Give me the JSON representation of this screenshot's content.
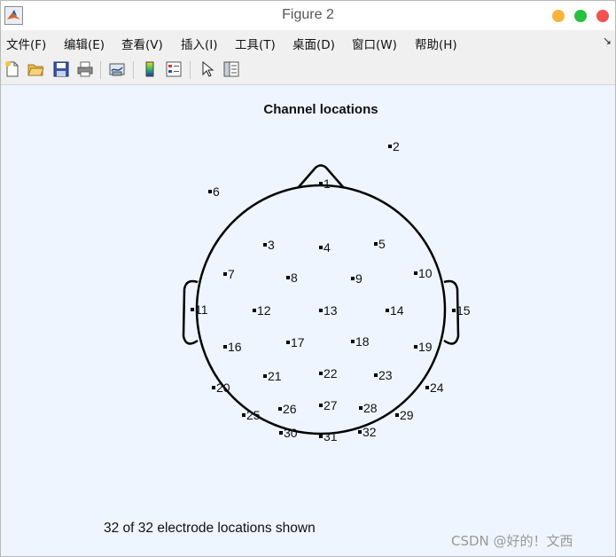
{
  "window": {
    "title": "Figure 2",
    "buttons": {
      "minimize_color": "#f6b53a",
      "maximize_color": "#27c13f",
      "close_color": "#f1524f"
    }
  },
  "menubar": {
    "items": [
      {
        "label": "文件(F)"
      },
      {
        "label": "编辑(E)"
      },
      {
        "label": "查看(V)"
      },
      {
        "label": "插入(I)"
      },
      {
        "label": "工具(T)"
      },
      {
        "label": "桌面(D)"
      },
      {
        "label": "窗口(W)"
      },
      {
        "label": "帮助(H)"
      }
    ],
    "overflow_icon": "dock-arrow-icon"
  },
  "toolbar": {
    "buttons": [
      {
        "name": "new-figure",
        "icon": "new-file-icon"
      },
      {
        "name": "open-file",
        "icon": "folder-open-icon"
      },
      {
        "name": "save",
        "icon": "save-icon"
      },
      {
        "name": "print",
        "icon": "printer-icon"
      },
      {
        "name": "link-plot",
        "icon": "link-plot-icon"
      },
      {
        "name": "insert-colorbar",
        "icon": "colorbar-icon"
      },
      {
        "name": "insert-legend",
        "icon": "legend-icon"
      },
      {
        "name": "edit-plot",
        "icon": "pointer-arrow-icon"
      },
      {
        "name": "property-inspector",
        "icon": "property-panel-icon"
      }
    ]
  },
  "plot": {
    "title": "Channel locations",
    "electrodes": [
      {
        "label": "1"
      },
      {
        "label": "2"
      },
      {
        "label": "3"
      },
      {
        "label": "4"
      },
      {
        "label": "5"
      },
      {
        "label": "6"
      },
      {
        "label": "7"
      },
      {
        "label": "8"
      },
      {
        "label": "9"
      },
      {
        "label": "10"
      },
      {
        "label": "11"
      },
      {
        "label": "12"
      },
      {
        "label": "13"
      },
      {
        "label": "14"
      },
      {
        "label": "15"
      },
      {
        "label": "16"
      },
      {
        "label": "17"
      },
      {
        "label": "18"
      },
      {
        "label": "19"
      },
      {
        "label": "20"
      },
      {
        "label": "21"
      },
      {
        "label": "22"
      },
      {
        "label": "23"
      },
      {
        "label": "24"
      },
      {
        "label": "25"
      },
      {
        "label": "26"
      },
      {
        "label": "27"
      },
      {
        "label": "28"
      },
      {
        "label": "29"
      },
      {
        "label": "30"
      },
      {
        "label": "31"
      },
      {
        "label": "32"
      }
    ],
    "status": "32 of 32 electrode locations shown"
  },
  "watermark": "CSDN @好的！文西"
}
